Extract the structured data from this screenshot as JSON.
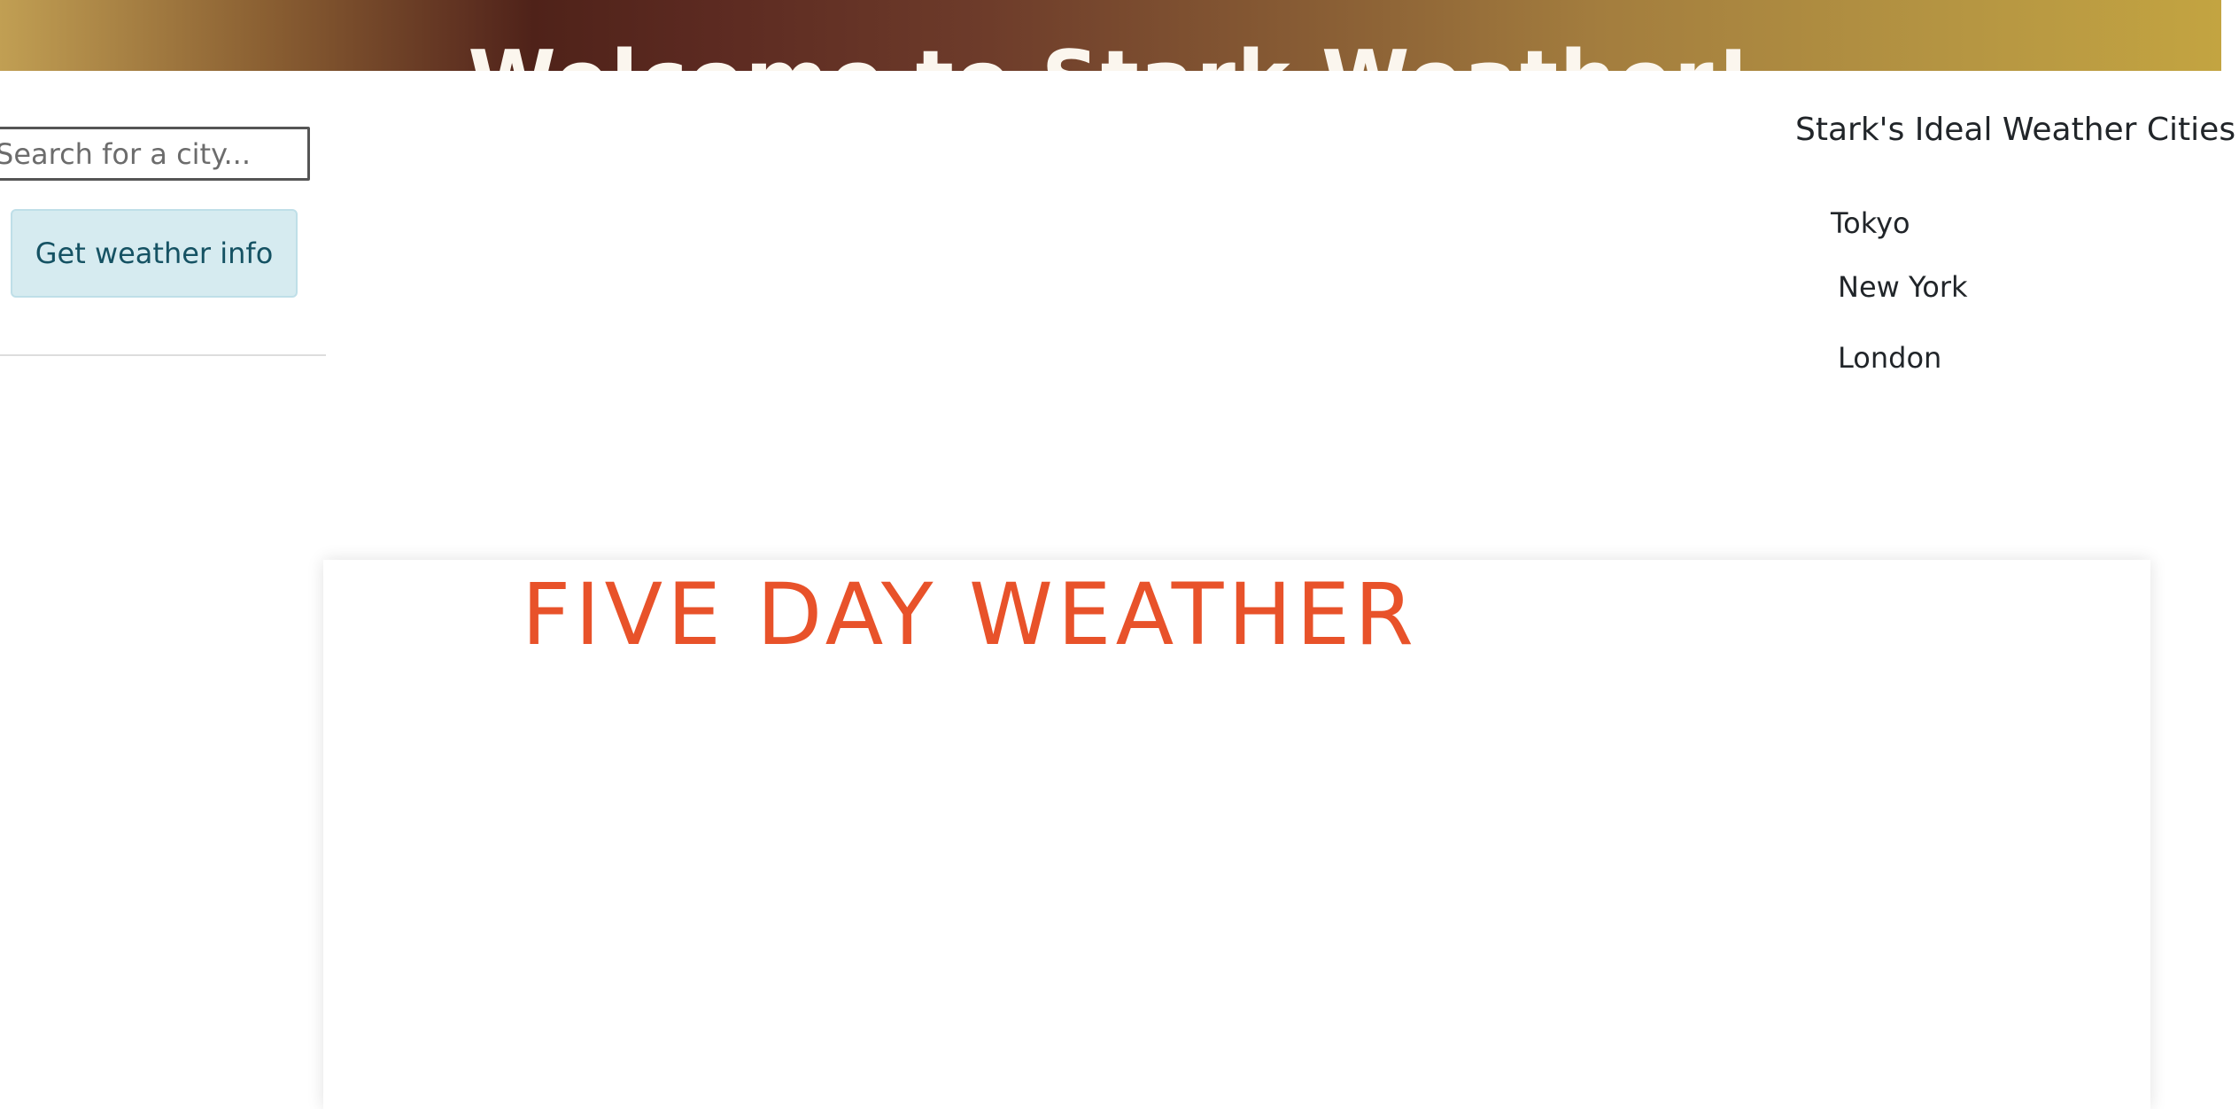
{
  "header": {
    "title": "Welcome to Stark Weather!"
  },
  "search": {
    "placeholder": "Search for a city...",
    "value": "",
    "button_label": "Get weather info"
  },
  "ideal_cities": {
    "heading": "Stark's Ideal Weather Cities",
    "items": [
      {
        "label": "Tokyo"
      },
      {
        "label": "New York"
      },
      {
        "label": "London"
      }
    ]
  },
  "forecast": {
    "heading": "FIVE DAY WEATHER"
  },
  "colors": {
    "banner_dark": "#4f2219",
    "banner_gold": "#c3a441",
    "button_bg": "#d6ebf0",
    "forecast_heading": "#e8522a"
  }
}
